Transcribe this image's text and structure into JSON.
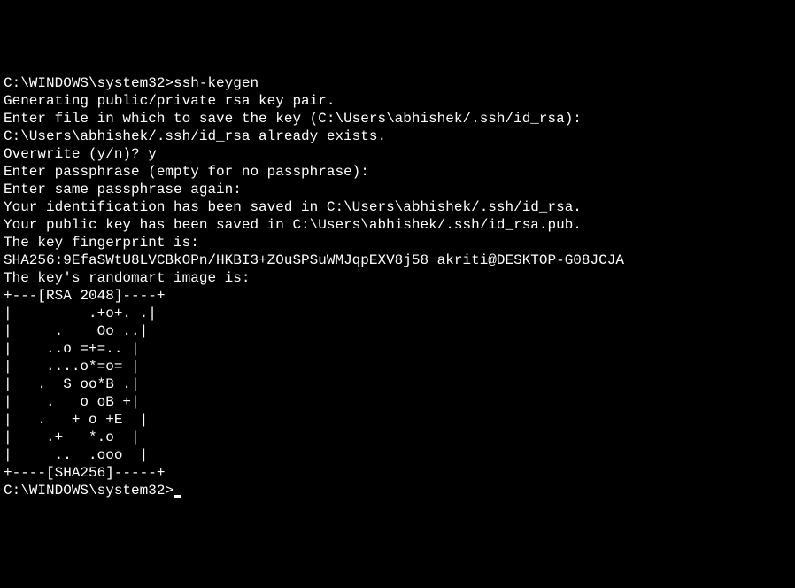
{
  "terminal": {
    "lines": [
      "C:\\WINDOWS\\system32>ssh-keygen",
      "Generating public/private rsa key pair.",
      "Enter file in which to save the key (C:\\Users\\abhishek/.ssh/id_rsa):",
      "C:\\Users\\abhishek/.ssh/id_rsa already exists.",
      "Overwrite (y/n)? y",
      "Enter passphrase (empty for no passphrase):",
      "Enter same passphrase again:",
      "Your identification has been saved in C:\\Users\\abhishek/.ssh/id_rsa.",
      "Your public key has been saved in C:\\Users\\abhishek/.ssh/id_rsa.pub.",
      "The key fingerprint is:",
      "SHA256:9EfaSWtU8LVCBkOPn/HKBI3+ZOuSPSuWMJqpEXV8j58 akriti@DESKTOP-G08JCJA",
      "The key's randomart image is:",
      "+---[RSA 2048]----+",
      "|         .+o+. .|",
      "|     .    Oo ..|",
      "|    ..o =+=.. |",
      "|    ....o*=o= |",
      "|   .  S oo*B .|",
      "|    .   o oB +|",
      "|   .   + o +E  |",
      "|    .+   *.o  |",
      "|     ..  .ooo  |",
      "+----[SHA256]-----+",
      "",
      "C:\\WINDOWS\\system32>"
    ]
  }
}
